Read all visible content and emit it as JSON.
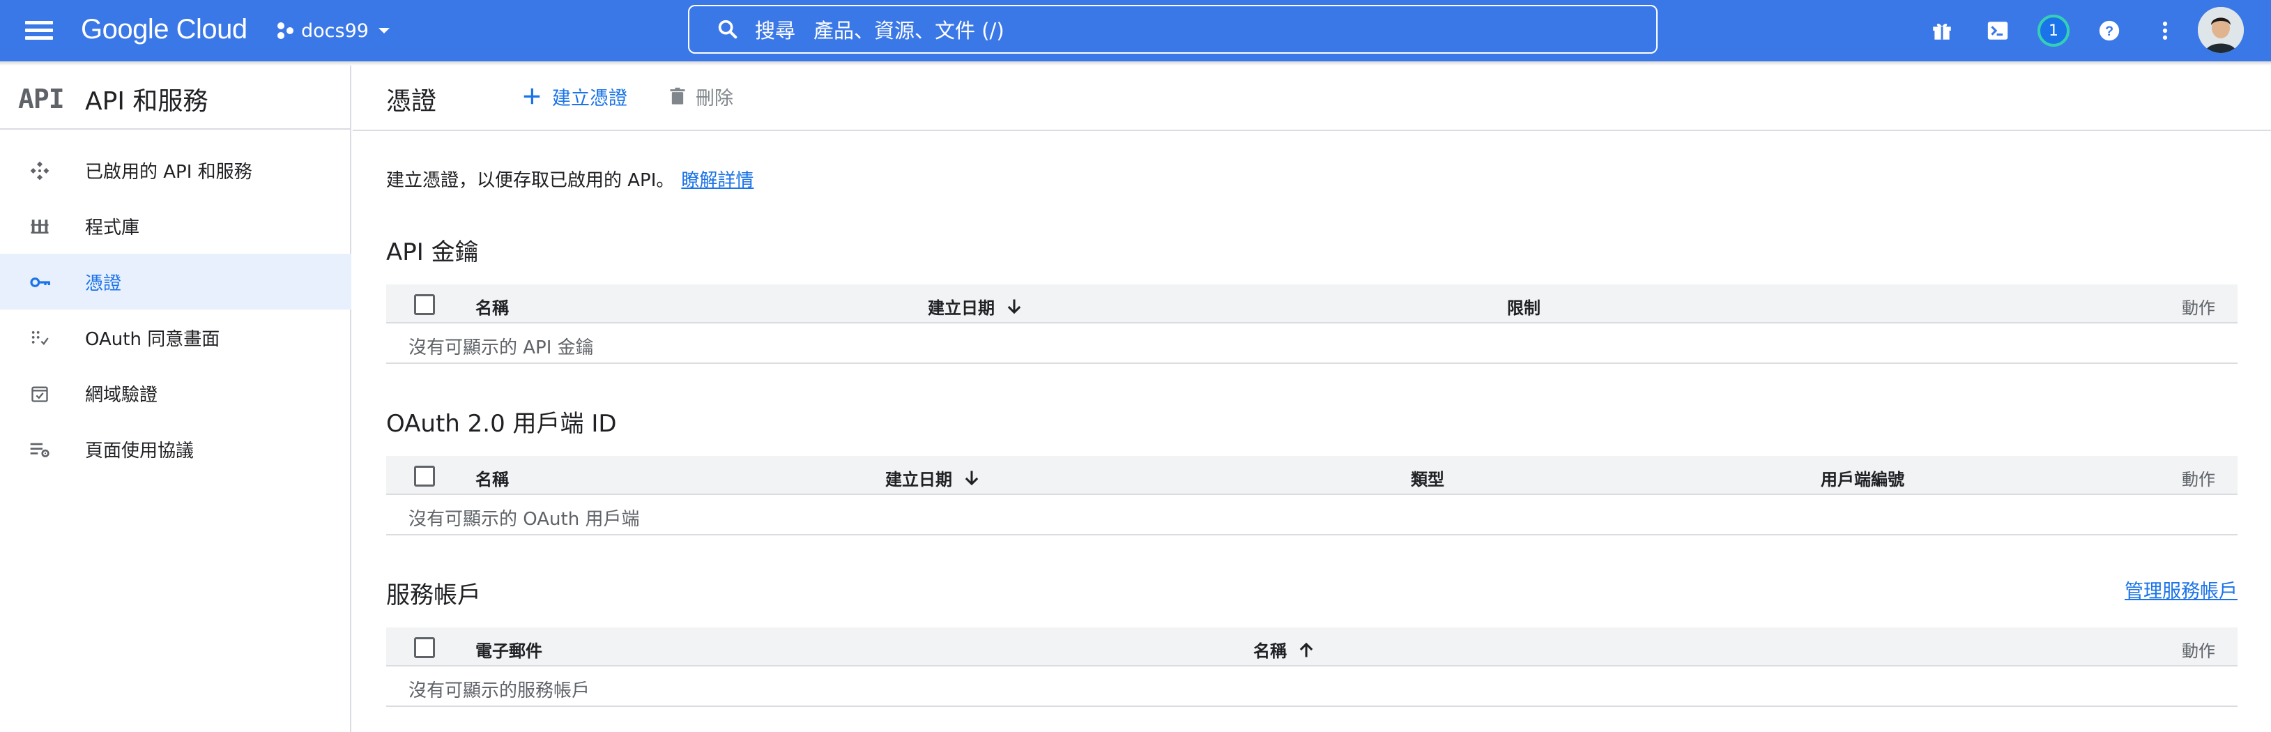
{
  "topbar": {
    "logo_text": "Google Cloud",
    "project_name": "docs99",
    "search_label": "搜尋",
    "search_placeholder": "產品、資源、文件 (/)",
    "notification_count": "1",
    "brand_color": "#3b78e7"
  },
  "sidebar": {
    "logo_text": "API",
    "title": "API 和服務",
    "items": [
      {
        "label": "已啟用的 API 和服務",
        "icon": "api-dots-icon",
        "active": false
      },
      {
        "label": "程式庫",
        "icon": "library-icon",
        "active": false
      },
      {
        "label": "憑證",
        "icon": "key-icon",
        "active": true
      },
      {
        "label": "OAuth 同意畫面",
        "icon": "oauth-consent-icon",
        "active": false
      },
      {
        "label": "網域驗證",
        "icon": "domain-check-icon",
        "active": false
      },
      {
        "label": "頁面使用協議",
        "icon": "page-settings-icon",
        "active": false
      }
    ]
  },
  "main": {
    "title": "憑證",
    "create_label": "建立憑證",
    "delete_label": "刪除",
    "intro_text": "建立憑證，以便存取已啟用的 API。",
    "learn_more": "瞭解詳情",
    "api_keys": {
      "title": "API 金鑰",
      "columns": [
        "名稱",
        "建立日期",
        "限制",
        "動作"
      ],
      "empty": "沒有可顯示的 API 金鑰"
    },
    "oauth": {
      "title": "OAuth 2.0 用戶端 ID",
      "columns": [
        "名稱",
        "建立日期",
        "類型",
        "用戶端編號",
        "動作"
      ],
      "empty": "沒有可顯示的 OAuth 用戶端"
    },
    "service_accounts": {
      "title": "服務帳戶",
      "manage_link": "管理服務帳戶",
      "columns": [
        "電子郵件",
        "名稱",
        "動作"
      ],
      "empty": "沒有可顯示的服務帳戶"
    }
  }
}
